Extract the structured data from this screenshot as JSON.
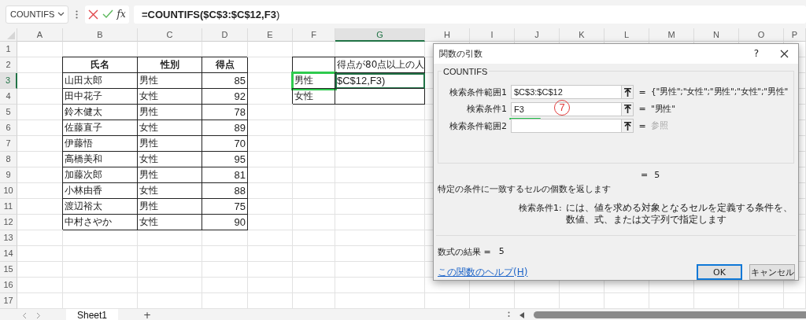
{
  "formula_bar": {
    "name_box": "COUNTIFS",
    "function_button": "fx",
    "formula": "**=COUNTIFS($C$3:$C$12,F3**)"
  },
  "sheet": {
    "columns": [
      {
        "label": "A",
        "selected": false
      },
      {
        "label": "B",
        "selected": false
      },
      {
        "label": "C",
        "selected": false
      },
      {
        "label": "D",
        "selected": false
      },
      {
        "label": "E",
        "selected": false
      },
      {
        "label": "F",
        "selected": false
      },
      {
        "label": "G",
        "selected": true
      },
      {
        "label": "H",
        "selected": false
      },
      {
        "label": "I",
        "selected": false
      },
      {
        "label": "J",
        "selected": false
      },
      {
        "label": "K",
        "selected": false
      },
      {
        "label": "L",
        "selected": false
      },
      {
        "label": "M",
        "selected": false
      },
      {
        "label": "N",
        "selected": false
      },
      {
        "label": "O",
        "selected": false
      },
      {
        "label": "P",
        "selected": false
      }
    ],
    "rows": [
      {
        "label": "1",
        "selected": false,
        "cells": []
      },
      {
        "label": "2",
        "selected": false,
        "cells": [
          null,
          {
            "text": "氏名",
            "kind": "header",
            "bordered": true
          },
          {
            "text": "性別",
            "kind": "header",
            "bordered": true
          },
          {
            "text": "得点",
            "kind": "header",
            "bordered": true
          },
          null,
          {
            "bordered": true,
            "reference": false,
            "active": false
          },
          {
            "text": "得点が80点以上の人",
            "kind": "text",
            "bordered": true,
            "reference": false,
            "active": false
          }
        ]
      },
      {
        "label": "3",
        "selected": true,
        "cells": [
          null,
          {
            "text": "山田太郎",
            "kind": "text",
            "bordered": true
          },
          {
            "text": "男性",
            "kind": "text",
            "bordered": true
          },
          {
            "text": "85",
            "kind": "number",
            "bordered": true
          },
          null,
          {
            "text": "男性",
            "kind": "text",
            "bordered": true,
            "reference": true,
            "active": false
          },
          {
            "text": "$C$12,F3)",
            "kind": "text",
            "bordered": true,
            "reference": false,
            "active": true
          }
        ]
      },
      {
        "label": "4",
        "selected": false,
        "cells": [
          null,
          {
            "text": "田中花子",
            "kind": "text",
            "bordered": true
          },
          {
            "text": "女性",
            "kind": "text",
            "bordered": true
          },
          {
            "text": "92",
            "kind": "number",
            "bordered": true
          },
          null,
          {
            "text": "女性",
            "kind": "text",
            "bordered": true,
            "reference": false,
            "active": false
          },
          {
            "bordered": true,
            "reference": false,
            "active": false
          }
        ]
      },
      {
        "label": "5",
        "selected": false,
        "cells": [
          null,
          {
            "text": "鈴木健太",
            "kind": "text",
            "bordered": true
          },
          {
            "text": "男性",
            "kind": "text",
            "bordered": true
          },
          {
            "text": "78",
            "kind": "number",
            "bordered": true
          }
        ]
      },
      {
        "label": "6",
        "selected": false,
        "cells": [
          null,
          {
            "text": "佐藤直子",
            "kind": "text",
            "bordered": true
          },
          {
            "text": "女性",
            "kind": "text",
            "bordered": true
          },
          {
            "text": "89",
            "kind": "number",
            "bordered": true
          }
        ]
      },
      {
        "label": "7",
        "selected": false,
        "cells": [
          null,
          {
            "text": "伊藤悟",
            "kind": "text",
            "bordered": true
          },
          {
            "text": "男性",
            "kind": "text",
            "bordered": true
          },
          {
            "text": "70",
            "kind": "number",
            "bordered": true
          }
        ]
      },
      {
        "label": "8",
        "selected": false,
        "cells": [
          null,
          {
            "text": "高橋美和",
            "kind": "text",
            "bordered": true
          },
          {
            "text": "女性",
            "kind": "text",
            "bordered": true
          },
          {
            "text": "95",
            "kind": "number",
            "bordered": true
          }
        ]
      },
      {
        "label": "9",
        "selected": false,
        "cells": [
          null,
          {
            "text": "加藤次郎",
            "kind": "text",
            "bordered": true
          },
          {
            "text": "男性",
            "kind": "text",
            "bordered": true
          },
          {
            "text": "81",
            "kind": "number",
            "bordered": true
          }
        ]
      },
      {
        "label": "10",
        "selected": false,
        "cells": [
          null,
          {
            "text": "小林由香",
            "kind": "text",
            "bordered": true
          },
          {
            "text": "女性",
            "kind": "text",
            "bordered": true
          },
          {
            "text": "88",
            "kind": "number",
            "bordered": true
          }
        ]
      },
      {
        "label": "11",
        "selected": false,
        "cells": [
          null,
          {
            "text": "渡辺裕太",
            "kind": "text",
            "bordered": true
          },
          {
            "text": "男性",
            "kind": "text",
            "bordered": true
          },
          {
            "text": "75",
            "kind": "number",
            "bordered": true
          }
        ]
      },
      {
        "label": "12",
        "selected": false,
        "cells": [
          null,
          {
            "text": "中村さやか",
            "kind": "text",
            "bordered": true
          },
          {
            "text": "女性",
            "kind": "text",
            "bordered": true
          },
          {
            "text": "90",
            "kind": "number",
            "bordered": true
          }
        ]
      },
      {
        "label": "13",
        "selected": false,
        "cells": []
      },
      {
        "label": "14",
        "selected": false,
        "cells": []
      },
      {
        "label": "15",
        "selected": false,
        "cells": []
      },
      {
        "label": "16",
        "selected": false,
        "cells": []
      },
      {
        "label": "17",
        "selected": false,
        "cells": []
      }
    ]
  },
  "sheet_tabs": {
    "tabs": [
      {
        "label": "Sheet1",
        "selected": true
      }
    ],
    "add_button": "+"
  },
  "dialog": {
    "title": "関数の引数",
    "help_button": "?",
    "function_name": "COUNTIFS",
    "arguments": [
      {
        "label": "検索条件範囲1",
        "value": "$C$3:$C$12",
        "equals": "=",
        "result": "{\"男性\";\"女性\";\"男性\";\"女性\";\"男性\"",
        "muted": false
      },
      {
        "label": "検索条件1",
        "value": "F3",
        "equals": "=",
        "result": "\"男性\"",
        "muted": false,
        "annotation": "7"
      },
      {
        "label": "検索条件範囲2",
        "equals": "=",
        "result": "参照",
        "muted": true
      }
    ],
    "total": {
      "equals": "=",
      "value": "5"
    },
    "description": "特定の条件に一致するセルの個数を返します",
    "argument_help": {
      "label": "検索条件1:",
      "text": "には、値を求める対象となるセルを定義する条件を、数値、式、または文字列で指定します"
    },
    "formula_result": {
      "label": "数式の結果 =",
      "value": "5"
    },
    "help_link": "この関数のヘルプ(H)",
    "buttons": [
      {
        "label": "OK",
        "default": true
      },
      {
        "label": "キャンセル",
        "default": false
      }
    ]
  }
}
